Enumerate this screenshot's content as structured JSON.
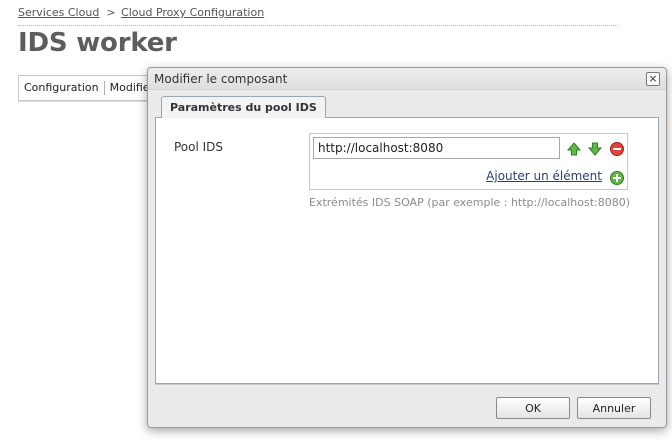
{
  "breadcrumb": {
    "items": [
      "Services Cloud",
      "Cloud Proxy Configuration"
    ],
    "separator": ">"
  },
  "page": {
    "title": "IDS worker",
    "tabs": [
      "Configuration",
      "Modifier"
    ]
  },
  "dialog": {
    "title": "Modifier le composant",
    "close_label": "×",
    "tab_label": "Paramètres du pool IDS",
    "field": {
      "label": "Pool IDS",
      "value": "http://localhost:8080",
      "help": "Extrémités IDS SOAP (par exemple : http://localhost:8080)",
      "add_label": "Ajouter un élément"
    },
    "ok_label": "OK",
    "cancel_label": "Annuler"
  },
  "icons": {
    "move_up": "arrow-up-icon",
    "move_down": "arrow-down-icon",
    "remove": "remove-icon",
    "add": "add-icon"
  },
  "colors": {
    "accent_green": "#4fa636",
    "remove_red": "#d9342b",
    "link_blue": "#2a3f78"
  }
}
